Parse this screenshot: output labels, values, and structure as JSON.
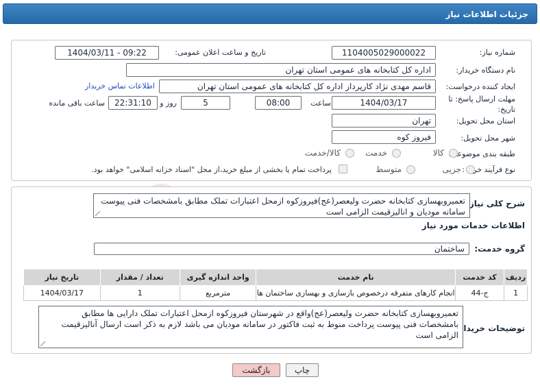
{
  "header": {
    "title": "جزئیات اطلاعات نیاز"
  },
  "info": {
    "need_number_label": "شماره نیاز:",
    "need_number": "1104005029000022",
    "announce_label": "تاریخ و ساعت اعلان عمومی:",
    "announce_value": "1404/03/11 - 09:22",
    "buyer_org_label": "نام دستگاه خریدار:",
    "buyer_org": "اداره کل کتابخانه های عمومی استان تهران",
    "creator_label": "ایجاد کننده درخواست:",
    "creator": "قاسم مهدی نژاد کارپرداز اداره کل کتابخانه های عمومی استان تهران",
    "contact_link": "اطلاعات تماس خریدار",
    "deadline_label_1": "مهلت ارسال پاسخ: تا",
    "deadline_label_2": "تاریخ:",
    "deadline_date": "1404/03/17",
    "time_label": "ساعت",
    "deadline_time": "08:00",
    "days_value": "5",
    "days_label": "روز و",
    "remaining_time": "22:31:10",
    "remaining_label": "ساعت باقی مانده",
    "province_label": "استان محل تحویل:",
    "province": "تهران",
    "city_label": "شهر محل تحویل:",
    "city": "فیروز کوه",
    "category_label": "طبقه بندی موضوعی:",
    "category_options": [
      "کالا",
      "خدمت",
      "کالا/خدمت"
    ],
    "process_label": "نوع فرآیند خرید :",
    "process_options": [
      "جزیی",
      "متوسط"
    ],
    "payment_note": "پرداخت تمام یا بخشی از مبلغ خرید،از محل \"اسناد خزانه اسلامی\" خواهد بود."
  },
  "summary": {
    "label": "شرح کلی نیاز:",
    "text": "تعمیروبهسازی کتابخانه حضرت ولیعصر(عج)فیروزکوه ازمحل اعتبارات تملک مطابق بامشخصات فنی پیوست سامانه مودیان و انالیزقیمت الزامی است"
  },
  "services": {
    "title": "اطلاعات خدمات مورد نیاز",
    "group_label": "گروه خدمت:",
    "group_value": "ساختمان",
    "columns": [
      "ردیف",
      "کد خدمت",
      "نام خدمت",
      "واحد اندازه گیری",
      "تعداد / مقدار",
      "تاریخ نیاز"
    ],
    "rows": [
      [
        "1",
        "ج-44",
        "انجام کارهای متفرقه درخصوص بازسازی و بهسازی ساختمان ها",
        "مترمربع",
        "1",
        "1404/03/17"
      ]
    ]
  },
  "buyer_notes": {
    "label": "توضیحات خریدار:",
    "text": "تعمیروبهسازی کتابخانه حضرت ولیعصر(عج)واقع در شهرستان فیروزکوه ازمحل اعتبارات تملک دارایی ها مطابق بامشخصات فنی پیوست پرداخت منوط به ثبت فاکتور در سامانه مودیان می باشد لازم به ذکر است ارسال آنالیزقیمت الزامی است"
  },
  "buttons": {
    "print": "چاپ",
    "back": "بازگشت"
  },
  "watermark": {
    "text": "AriaTender.net"
  },
  "colors": {
    "header": "#2f77b8",
    "back_button": "#f3c9c9",
    "link": "#1e4fbf",
    "table_header": "#d6d6d6"
  }
}
